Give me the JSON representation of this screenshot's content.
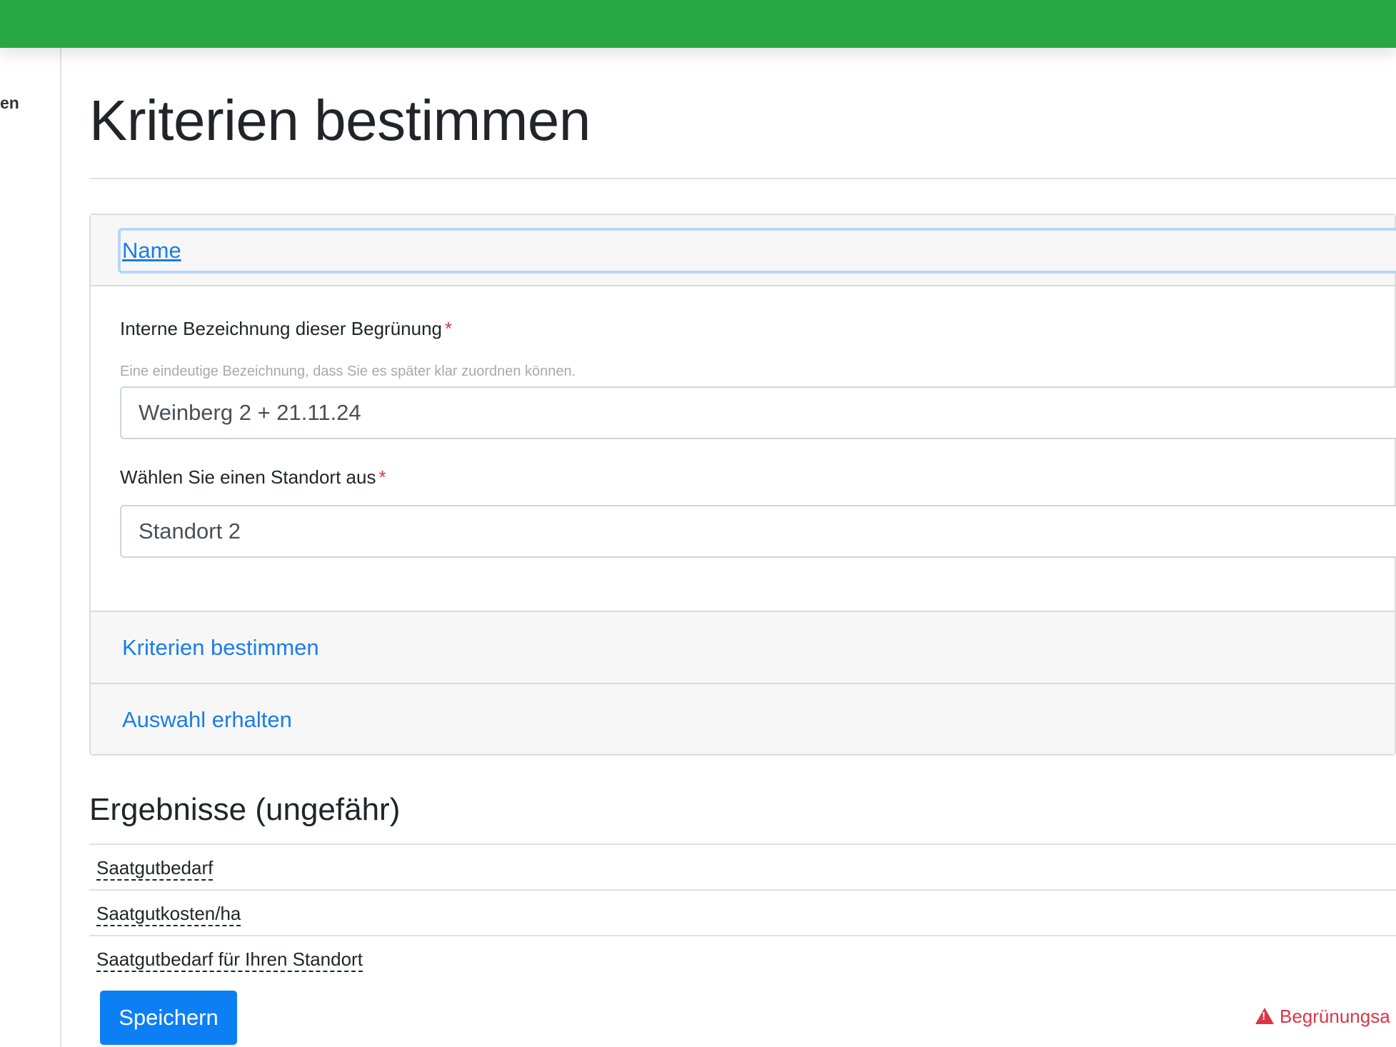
{
  "sidebar": {
    "partial_label": "en"
  },
  "page": {
    "title": "Kriterien bestimmen"
  },
  "accordion": {
    "name_header": "Name",
    "name_body": {
      "field1_label": "Interne Bezeichnung dieser Begrünung",
      "required_marker": "*",
      "field1_help": "Eine eindeutige Bezeichnung, dass Sie es später klar zuordnen können.",
      "field1_value": "Weinberg 2 + 21.11.24",
      "field2_label": "Wählen Sie einen Standort aus",
      "field2_value": "Standort 2"
    },
    "kriterien_header": "Kriterien bestimmen",
    "auswahl_header": "Auswahl erhalten"
  },
  "results": {
    "title": "Ergebnisse (ungefähr)",
    "rows": [
      "Saatgutbedarf",
      "Saatgutkosten/ha",
      "Saatgutbedarf für Ihren Standort"
    ]
  },
  "actions": {
    "save_label": "Speichern",
    "warning_text": "Begrünungsa"
  },
  "colors": {
    "topbar": "#28a745",
    "link": "#1a7de8",
    "primary": "#0d7ff5",
    "danger": "#dc3545"
  }
}
